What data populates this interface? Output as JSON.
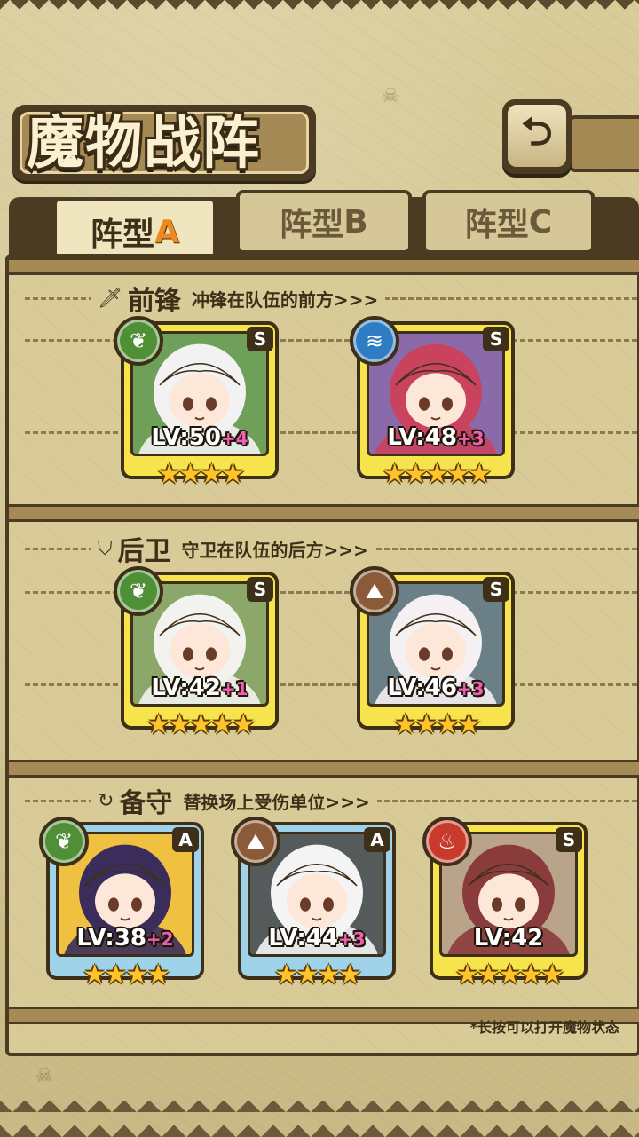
{
  "header": {
    "title": "魔物战阵",
    "back_glyph": "⮌"
  },
  "tabs": [
    {
      "label": "阵型",
      "letter": "A",
      "active": true
    },
    {
      "label": "阵型",
      "letter": "B",
      "active": false
    },
    {
      "label": "阵型",
      "letter": "C",
      "active": false
    }
  ],
  "sections": {
    "front": {
      "icon": "sword-icon",
      "name": "前锋",
      "desc": "冲锋在队伍的前方>>>"
    },
    "rear": {
      "icon": "shield-icon",
      "name": "后卫",
      "desc": "守卫在队伍的后方>>>"
    },
    "reserve": {
      "icon": "swap-icon",
      "name": "备守",
      "desc": "替换场上受伤单位>>>"
    }
  },
  "cards": [
    {
      "slot": "front-1",
      "element": "wood",
      "rank": "S",
      "level": "LV:50",
      "plus": "+4",
      "stars": "★★★★",
      "star_count": 4,
      "hair": "#f2f2f2",
      "bg": "#6fa05a"
    },
    {
      "slot": "front-2",
      "element": "water",
      "rank": "S",
      "level": "LV:48",
      "plus": "+3",
      "stars": "★★★★★",
      "star_count": 5,
      "hair": "#c9435e",
      "bg": "#8a6aa8"
    },
    {
      "slot": "rear-1",
      "element": "wood",
      "rank": "S",
      "level": "LV:42",
      "plus": "+1",
      "stars": "★★★★★",
      "star_count": 5,
      "hair": "#f2f2ee",
      "bg": "#8ba86a"
    },
    {
      "slot": "rear-2",
      "element": "earth",
      "rank": "S",
      "level": "LV:46",
      "plus": "+3",
      "stars": "★★★★",
      "star_count": 4,
      "hair": "#f5f0f2",
      "bg": "#6a7f86"
    },
    {
      "slot": "reserve-1",
      "element": "wood",
      "rank": "A",
      "level": "LV:38",
      "plus": "+2",
      "stars": "★★★★",
      "star_count": 4,
      "hair": "#3a2d5c",
      "bg": "#f0c040"
    },
    {
      "slot": "reserve-2",
      "element": "earth",
      "rank": "A",
      "level": "LV:44",
      "plus": "+3",
      "stars": "★★★★",
      "star_count": 4,
      "hair": "#f4f4f4",
      "bg": "#555a5a"
    },
    {
      "slot": "reserve-3",
      "element": "fire",
      "rank": "S",
      "level": "LV:42",
      "plus": "",
      "stars": "★★★★★",
      "star_count": 5,
      "hair": "#8a3b3b",
      "bg": "#b9a48a"
    }
  ],
  "element_glyphs": {
    "wood": "❦",
    "water": "≋",
    "earth": "⛰",
    "fire": "♨"
  },
  "footer": {
    "hint": "*长按可以打开魔物状态"
  }
}
